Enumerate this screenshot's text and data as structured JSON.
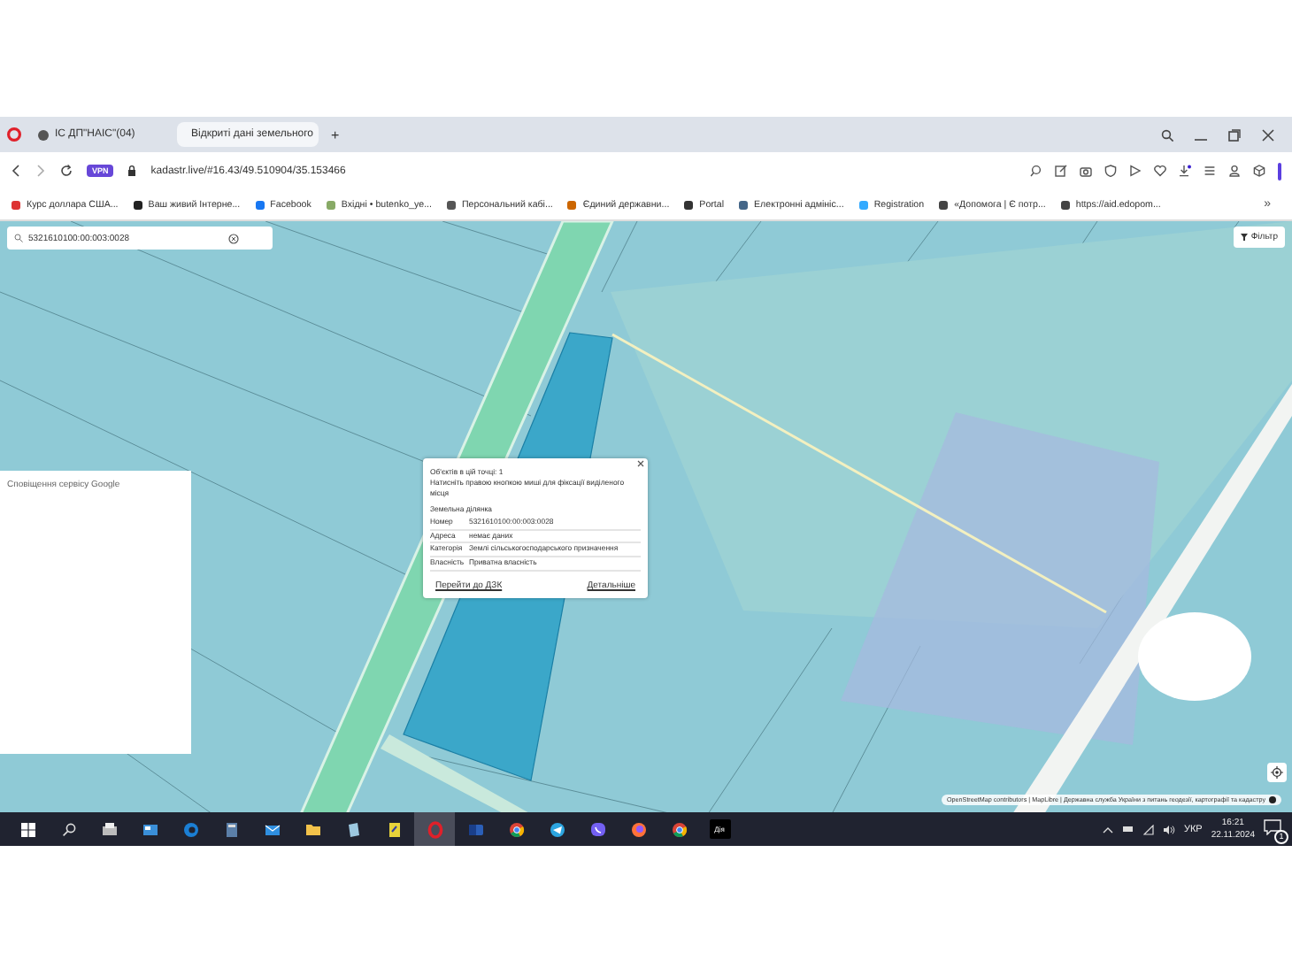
{
  "browser": {
    "tabs": [
      {
        "title": "ІС ДП\"НАІС\"(04)",
        "selected": false
      },
      {
        "title": "Відкриті дані земельного",
        "selected": true
      }
    ],
    "new_tab": "+",
    "vpn_badge": "VPN",
    "address": "kadastr.live/#16.43/49.510904/35.153466",
    "bookmarks": [
      {
        "title": "Курс доллара США..."
      },
      {
        "title": "Ваш живий Інтерне..."
      },
      {
        "title": "Facebook"
      },
      {
        "title": "Вхідні • butenko_ye..."
      },
      {
        "title": "Персональний кабі..."
      },
      {
        "title": "Єдиний державни..."
      },
      {
        "title": "Portal"
      },
      {
        "title": "Електронні адмініс..."
      },
      {
        "title": "Registration"
      },
      {
        "title": "«Допомога | Є потр..."
      },
      {
        "title": "https://aid.edopom..."
      }
    ],
    "bookmarks_more": "»"
  },
  "map": {
    "search": {
      "value": "5321610100:00:003:0028"
    },
    "filter_button": "Фільтр",
    "side_panel": "Сповіщення сервісу Google",
    "popup": {
      "count_line": "Об'єктів в цій точці: 1",
      "hint": "Натисніть правою кнопкою миші для фіксації виділеного місця",
      "section": "Земельна ділянка",
      "fields": [
        {
          "label": "Номер",
          "value": "5321610100:00:003:0028"
        },
        {
          "label": "Адреса",
          "value": "немає даних"
        },
        {
          "label": "Категорія",
          "value": "Землі сільськогосподарського призначення"
        },
        {
          "label": "Власність",
          "value": "Приватна власність"
        }
      ],
      "actions": [
        "Перейти до ДЗК",
        "Детальніше"
      ]
    },
    "attribution": "OpenStreetMap contributors | MapLibre | Державна служба України з питань геодезії, картографії та кадастру"
  },
  "taskbar": {
    "apps": [
      {
        "kind": "terminal",
        "selected": false
      },
      {
        "kind": "mail-app",
        "selected": false
      },
      {
        "kind": "edge",
        "selected": false
      },
      {
        "kind": "calculator",
        "selected": false
      },
      {
        "kind": "mail",
        "selected": false
      },
      {
        "kind": "folder",
        "selected": false
      },
      {
        "kind": "notes",
        "selected": false
      },
      {
        "kind": "document",
        "selected": false
      },
      {
        "kind": "opera",
        "selected": true
      },
      {
        "kind": "word",
        "selected": false
      },
      {
        "kind": "chrome",
        "selected": false
      },
      {
        "kind": "telegram",
        "selected": false
      },
      {
        "kind": "viber",
        "selected": false
      },
      {
        "kind": "firefox",
        "selected": false
      },
      {
        "kind": "chrome",
        "selected": false
      },
      {
        "kind": "diia",
        "selected": false,
        "label": "Дія"
      }
    ],
    "language": "УКР",
    "time": "16:21",
    "date": "22.11.2024",
    "notifications": "1"
  }
}
